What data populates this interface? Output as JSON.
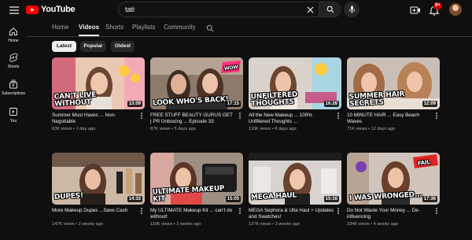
{
  "header": {
    "logo_text": "YouTube",
    "notification_count": "9+"
  },
  "search": {
    "query": "tati",
    "placeholder": "Search"
  },
  "sidebar": {
    "items": [
      {
        "label": "Home",
        "icon": "home-icon"
      },
      {
        "label": "Shorts",
        "icon": "shorts-icon"
      },
      {
        "label": "Subscriptions",
        "icon": "subscriptions-icon"
      },
      {
        "label": "You",
        "icon": "you-icon"
      }
    ]
  },
  "tabs": [
    {
      "label": "Home",
      "active": false
    },
    {
      "label": "Videos",
      "active": true
    },
    {
      "label": "Shorts",
      "active": false
    },
    {
      "label": "Playlists",
      "active": false
    },
    {
      "label": "Community",
      "active": false
    }
  ],
  "chips": [
    {
      "label": "Latest",
      "selected": true
    },
    {
      "label": "Popular",
      "selected": false
    },
    {
      "label": "Oldest",
      "selected": false
    }
  ],
  "videos": [
    {
      "title": "Summer Must Haves ... Non-Negotiable",
      "views": "63K views",
      "age": "1 day ago",
      "duration": "13:09",
      "overlay": "CAN'T LIVE WITHOUT"
    },
    {
      "title": "FREE STUFF BEAUTY GURUS GET | PR Unboxing ... Episode 33",
      "views": "87K views",
      "age": "5 days ago",
      "duration": "17:15",
      "overlay": "LOOK WHO'S BACK!",
      "sticker": "WOW"
    },
    {
      "title": "All the New Makeup ... 100% Unfiltered Thoughts ...",
      "views": "110K views",
      "age": "8 days ago",
      "duration": "16:26",
      "overlay": "UNFILTERED THOUGHTS"
    },
    {
      "title": "10 MINUTE HAIR ... Easy Beach Waves",
      "views": "71K views",
      "age": "12 days ago",
      "duration": "12:09",
      "overlay": "SUMMER HAIR SECRETS"
    },
    {
      "title": "More Makeup Dupes ...Save Cash",
      "views": "147K views",
      "age": "2 weeks ago",
      "duration": "14:33",
      "overlay": "DUPES!"
    },
    {
      "title": "My ULTIMATE Makeup Kit ... can't do without!",
      "views": "110K views",
      "age": "2 weeks ago",
      "duration": "15:05",
      "overlay": "ULTIMATE MAKEUP KIT"
    },
    {
      "title": "MEGA Sephora & Ulta Haul + Updates and Swatches!",
      "views": "127K views",
      "age": "3 weeks ago",
      "duration": "15:16",
      "overlay": "MEGA HAUL"
    },
    {
      "title": "Do Not Waste Your Money ... De-influencing",
      "views": "234K views",
      "age": "4 weeks ago",
      "duration": "17:36",
      "overlay": "I WAS WRONGED...",
      "sticker": "FAIL"
    }
  ],
  "colors": {
    "background": "#0f0f0f",
    "brand_red": "#ff0000",
    "chip_bg": "#272727",
    "text_primary": "#f1f1f1",
    "text_secondary": "#aaaaaa"
  }
}
